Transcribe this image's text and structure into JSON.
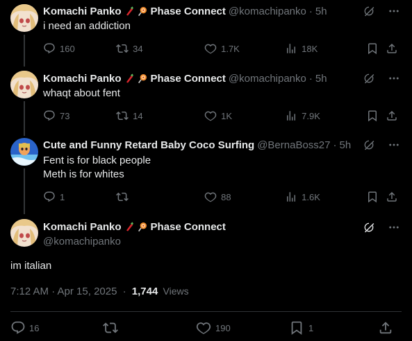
{
  "replies": [
    {
      "name": "Komachi Panko",
      "affiliation": "Phase Connect",
      "handle": "@komachipanko",
      "time": "5h",
      "text": [
        "i need an addiction"
      ],
      "stats": {
        "replies": "160",
        "reposts": "34",
        "likes": "1.7K",
        "views": "18K"
      }
    },
    {
      "name": "Komachi Panko",
      "affiliation": "Phase Connect",
      "handle": "@komachipanko",
      "time": "5h",
      "text": [
        "whaqt about fent"
      ],
      "stats": {
        "replies": "73",
        "reposts": "14",
        "likes": "1K",
        "views": "7.9K"
      }
    },
    {
      "name": "Cute and Funny Retard Baby Coco Surfing",
      "affiliation": "",
      "handle": "@BernaBoss27",
      "time": "5h",
      "text": [
        "Fent is for black people",
        "Meth is for whites"
      ],
      "stats": {
        "replies": "1",
        "reposts": "",
        "likes": "88",
        "views": "1.6K"
      }
    }
  ],
  "main": {
    "name": "Komachi Panko",
    "affiliation": "Phase Connect",
    "handle": "@komachipanko",
    "text": "im italian",
    "timestamp": "7:12 AM · Apr 15, 2025",
    "dot": "·",
    "views_count": "1,744",
    "views_label": "Views",
    "stats": {
      "replies": "16",
      "reposts": "",
      "likes": "190",
      "bookmarks": "1"
    }
  },
  "icons": {
    "grok": "grok-icon",
    "more": "more-icon",
    "reply": "reply-icon",
    "repost": "repost-icon",
    "like": "like-icon",
    "views": "views-icon",
    "bookmark": "bookmark-icon",
    "share": "share-icon",
    "badge_tomato": "tomato-badge-icon",
    "badge_lollipop": "lollipop-badge-icon"
  },
  "colors": {
    "background": "#000000",
    "text": "#e7e9ea",
    "muted": "#71767b",
    "divider": "#2f3336"
  }
}
